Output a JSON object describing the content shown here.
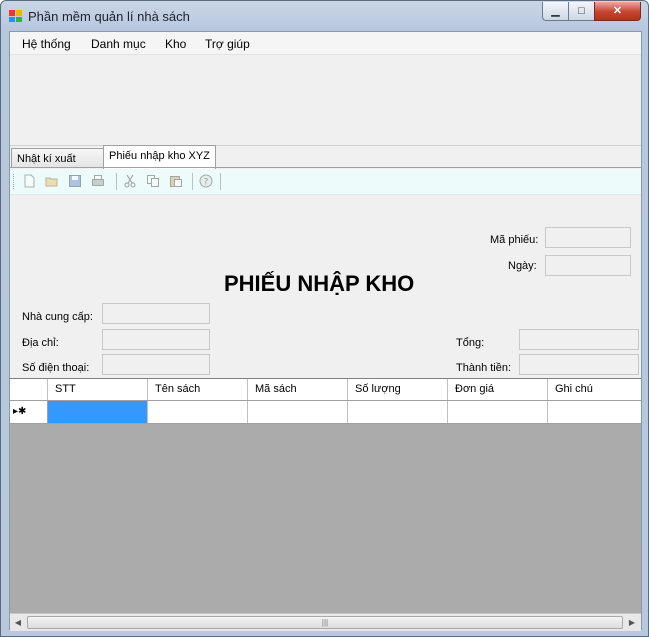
{
  "window": {
    "title": "Phần mềm quản lí nhà sách",
    "controls": {
      "minimize": "▁",
      "maximize": "□",
      "close": "✕"
    }
  },
  "menu": [
    "Hệ thống",
    "Danh mục",
    "Kho",
    "Trợ giúp"
  ],
  "tabs": [
    "Nhật kí xuất nhập",
    "Phiếu nhập kho XYZ"
  ],
  "toolbar": {
    "icons": [
      "new-document-icon",
      "open-folder-icon",
      "save-icon",
      "print-icon",
      "cut-icon",
      "copy-icon",
      "paste-icon",
      "help-icon"
    ]
  },
  "form": {
    "title": "PHIẾU NHẬP KHO",
    "ma_phieu_label": "Mã phiếu:",
    "ngay_label": "Ngày:",
    "nha_cung_cap_label": "Nhà cung cấp:",
    "dia_chi_label": "Địa chỉ:",
    "so_dien_thoai_label": "Số điện thoại:",
    "tong_label": "Tổng:",
    "thanh_tien_label": "Thành tiền:"
  },
  "grid": {
    "columns": [
      "STT",
      "Tên sách",
      "Mã sách",
      "Số lượng",
      "Đơn giá",
      "Ghi chú"
    ],
    "new_row_indicator": "▸✱"
  },
  "scrollbar": {
    "left_arrow": "◀",
    "right_arrow": "▶",
    "thumb_grip": "|||"
  }
}
